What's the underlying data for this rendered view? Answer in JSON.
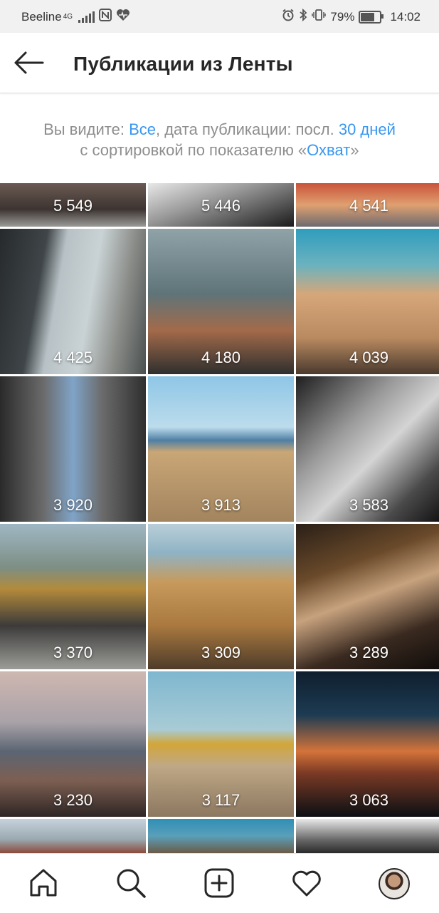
{
  "status_bar": {
    "carrier": "Beeline",
    "network": "4G",
    "battery": "79%",
    "battery_fraction": 0.79,
    "time": "14:02",
    "icons": [
      "nfc-icon",
      "health-icon",
      "alarm-icon",
      "bluetooth-icon",
      "vibrate-icon",
      "battery-icon"
    ]
  },
  "header": {
    "title": "Публикации из Ленты",
    "back_icon": "arrow-left-icon"
  },
  "filter": {
    "prefix": "Вы видите: ",
    "scope": "Все",
    "middle": ", дата публикации: посл. ",
    "period": "30 дней",
    "line2_prefix": "с сортировкой по показателю «",
    "metric": "Охват",
    "line2_suffix": "»"
  },
  "posts": [
    {
      "count": "5 549"
    },
    {
      "count": "5 446"
    },
    {
      "count": "4 541"
    },
    {
      "count": "4 425"
    },
    {
      "count": "4 180"
    },
    {
      "count": "4 039"
    },
    {
      "count": "3 920"
    },
    {
      "count": "3 913"
    },
    {
      "count": "3 583"
    },
    {
      "count": "3 370"
    },
    {
      "count": "3 309"
    },
    {
      "count": "3 289"
    },
    {
      "count": "3 230"
    },
    {
      "count": "3 117"
    },
    {
      "count": "3 063"
    },
    {
      "count": ""
    },
    {
      "count": ""
    },
    {
      "count": ""
    }
  ],
  "bottom_nav": {
    "items": [
      "home-icon",
      "search-icon",
      "add-post-icon",
      "activity-heart-icon",
      "profile-avatar"
    ]
  }
}
